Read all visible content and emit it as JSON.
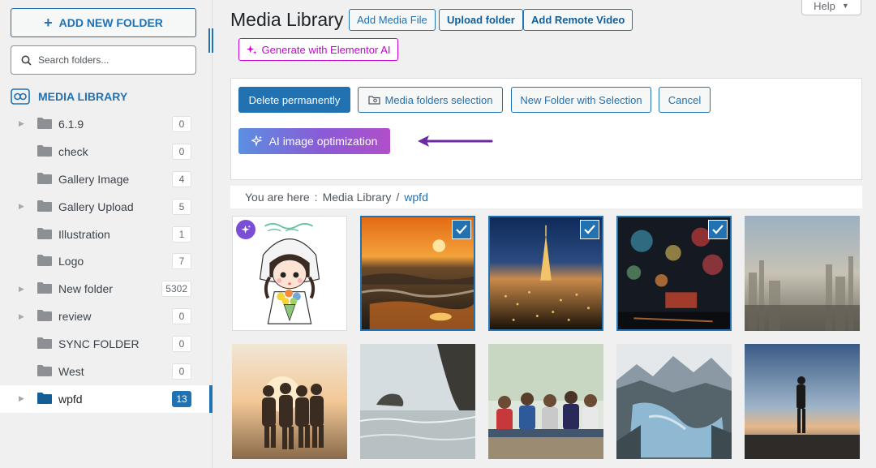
{
  "sidebar": {
    "add_folder_label": "ADD NEW FOLDER",
    "search_placeholder": "Search folders...",
    "library_label": "MEDIA LIBRARY",
    "folders": [
      {
        "name": "6.1.9",
        "count": "0",
        "expandable": true
      },
      {
        "name": "check",
        "count": "0",
        "expandable": false
      },
      {
        "name": "Gallery Image",
        "count": "4",
        "expandable": false
      },
      {
        "name": "Gallery Upload",
        "count": "5",
        "expandable": true
      },
      {
        "name": "Illustration",
        "count": "1",
        "expandable": false
      },
      {
        "name": "Logo",
        "count": "7",
        "expandable": false
      },
      {
        "name": "New folder",
        "count": "5302",
        "expandable": true
      },
      {
        "name": "review",
        "count": "0",
        "expandable": true
      },
      {
        "name": "SYNC FOLDER",
        "count": "0",
        "expandable": false
      },
      {
        "name": "West",
        "count": "0",
        "expandable": false
      },
      {
        "name": "wpfd",
        "count": "13",
        "expandable": true,
        "active": true
      }
    ]
  },
  "header": {
    "title": "Media Library",
    "add_media_label": "Add Media File",
    "upload_folder_label": "Upload folder",
    "add_remote_label": "Add Remote Video",
    "help_label": "Help",
    "elementor_label": "Generate with Elementor AI"
  },
  "actions": {
    "delete_label": "Delete permanently",
    "media_folders_label": "Media folders selection",
    "new_folder_label": "New Folder with Selection",
    "cancel_label": "Cancel",
    "ai_label": "AI image optimization"
  },
  "breadcrumb": {
    "prefix": "You are here",
    "separator": ":",
    "root": "Media Library",
    "slash": "/",
    "current": "wpfd"
  },
  "colors": {
    "accent": "#2271b1",
    "elementor": "#c800d6",
    "arrow": "#6b2aa0"
  }
}
